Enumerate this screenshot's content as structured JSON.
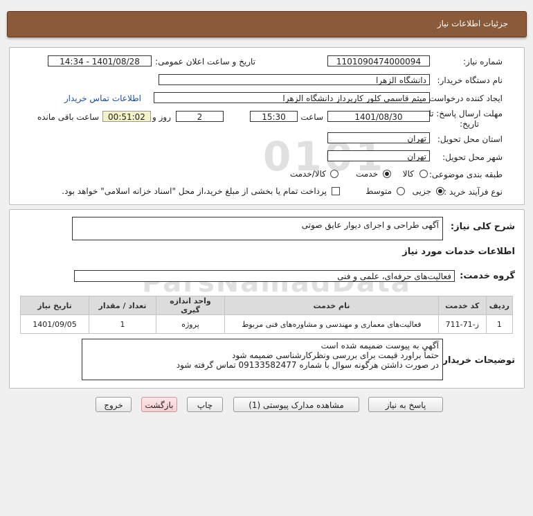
{
  "header": {
    "title": "جزئیات اطلاعات نیاز"
  },
  "info": {
    "need_number_label": "شماره نیاز:",
    "need_number": "1101090474000094",
    "announce_label": "تاریخ و ساعت اعلان عمومی:",
    "announce_value": "1401/08/28 - 14:34",
    "buyer_org_label": "نام دستگاه خریدار:",
    "buyer_org": "دانشگاه الزهرا",
    "requester_label": "ایجاد کننده درخواست:",
    "requester": "میثم  قاسمی کلور کارپرداز دانشگاه الزهرا",
    "contact_link": "اطلاعات تماس خریدار",
    "deadline_label_1": "مهلت ارسال پاسخ: تا",
    "deadline_label_2": "تاریخ:",
    "deadline_date": "1401/08/30",
    "time_label": "ساعت",
    "deadline_time": "15:30",
    "days_value": "2",
    "days_label": "روز و",
    "remaining_time": "00:51:02",
    "remaining_label": "ساعت باقی مانده",
    "province_label": "استان محل تحویل:",
    "province": "تهران",
    "city_label": "شهر محل تحویل:",
    "city": "تهران",
    "category_label": "طبقه بندی موضوعی:",
    "category_options": [
      "کالا",
      "خدمت",
      "کالا/خدمت"
    ],
    "category_selected": "خدمت",
    "process_label": "نوع فرآیند خرید :",
    "process_options": [
      "جزیی",
      "متوسط"
    ],
    "process_selected": "جزیی",
    "payment_note": "پرداخت تمام یا بخشی از مبلغ خرید،از محل \"اسناد خزانه اسلامی\" خواهد بود."
  },
  "summary": {
    "general_label": "شرح کلی نیاز:",
    "general_value": "آگهی طراحی و اجرای دیوار عایق صوتی",
    "services_title": "اطلاعات خدمات مورد نیاز",
    "group_label": "گروه خدمت:",
    "group_value": "فعالیت‌های حرفه‌ای، علمی و فنی",
    "table": {
      "headers": [
        "ردیف",
        "کد خدمت",
        "نام خدمت",
        "واحد اندازه گیری",
        "تعداد / مقدار",
        "تاریخ نیاز"
      ],
      "rows": [
        [
          "1",
          "ز-71-711",
          "فعالیت‌های معماری و مهندسی و مشاوره‌های فنی مربوط",
          "پروژه",
          "1",
          "1401/09/05"
        ]
      ]
    },
    "buyer_notes_label": "توضیحات خریدار:",
    "buyer_notes": [
      "آگهی به پیوست ضمیمه شده است",
      "حتماً براورد قیمت برای بررسی ونظرکارشناسی ضمیمه شود",
      "در صورت داشتن هرگونه سوال با شماره 09133582477 تماس گرفته شود"
    ]
  },
  "buttons": {
    "reply": "پاسخ به نیاز",
    "attachments": "مشاهده مدارک پیوستی (1)",
    "print": "چاپ",
    "back": "بازگشت",
    "exit": "خروج"
  },
  "watermark": {
    "text": "ParsNamadData",
    "digits": "0101"
  }
}
